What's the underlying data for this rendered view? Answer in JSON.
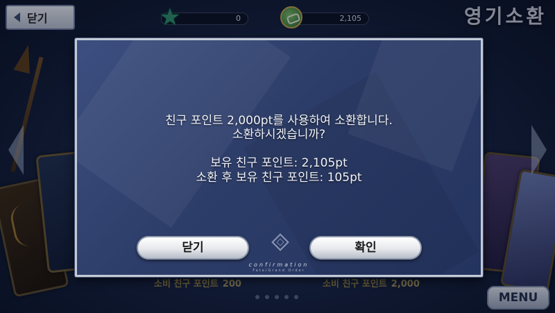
{
  "top_bar": {
    "close_label": "닫기",
    "saint_quartz_count": "0",
    "friend_points": "2,105",
    "screen_title": "영기소환"
  },
  "icons": {
    "back": "chevron-left-icon",
    "saint_quartz": "star-icon",
    "friend_point": "handshake-icon",
    "carousel_prev": "chevron-left-icon",
    "carousel_next": "chevron-right-icon",
    "confirm_emblem": "diamond-emblem-icon"
  },
  "background": {
    "summon_cost_1_label": "소비 친구 포인트",
    "summon_cost_1_value": "200",
    "summon_cost_2_label": "소비 친구 포인트",
    "summon_cost_2_value": "2,000",
    "menu_label": "MENU"
  },
  "dialog": {
    "line1": "친구 포인트 2,000pt를 사용하여 소환합니다.",
    "line2": "소환하시겠습니까?",
    "line3": "보유 친구 포인트: 2,105pt",
    "line4": "소환 후 보유 친구 포인트: 105pt",
    "close_button": "닫기",
    "confirm_button": "확인",
    "footer_word": "confirmation",
    "footer_brand": "Fate/Grand Order"
  },
  "colors": {
    "dialog_bg": "#2d3d69",
    "dialog_border": "#c2c9d6",
    "text": "#f2f4f8",
    "cost_gold": "#c8a84a"
  }
}
